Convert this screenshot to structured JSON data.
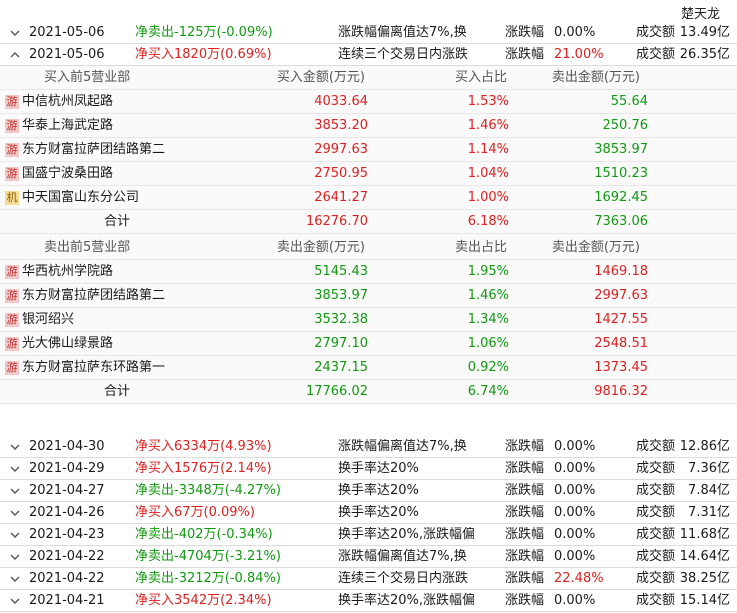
{
  "top_name": "楚天龙",
  "rows_top": [
    {
      "date": "2021-05-06",
      "flow": "净卖出-125万(-0.09%)",
      "flow_color": "green",
      "reason": "涨跌幅偏离值达7%,换",
      "pct_label": "涨跌幅",
      "pct": "0.00%",
      "pct_color": "normal",
      "tv_label": "成交额",
      "tv": "13.49亿",
      "expanded": false
    },
    {
      "date": "2021-05-06",
      "flow": "净买入1820万(0.69%)",
      "flow_color": "red",
      "reason": "连续三个交易日内涨跌",
      "pct_label": "涨跌幅",
      "pct": "21.00%",
      "pct_color": "red",
      "tv_label": "成交额",
      "tv": "26.35亿",
      "expanded": true
    }
  ],
  "buy_section": {
    "header": {
      "name": "买入前5营业部",
      "c1": "买入金额(万元)",
      "c2": "买入占比",
      "c3": "卖出金额(万元)"
    },
    "rows": [
      {
        "badge": "游",
        "badge_type": "you",
        "name": "中信杭州凤起路",
        "c1": "4033.64",
        "c2": "1.53%",
        "c3": "55.64"
      },
      {
        "badge": "游",
        "badge_type": "you",
        "name": "华泰上海武定路",
        "c1": "3853.20",
        "c2": "1.46%",
        "c3": "250.76"
      },
      {
        "badge": "游",
        "badge_type": "you",
        "name": "东方财富拉萨团结路第二",
        "c1": "2997.63",
        "c2": "1.14%",
        "c3": "3853.97"
      },
      {
        "badge": "游",
        "badge_type": "you",
        "name": "国盛宁波桑田路",
        "c1": "2750.95",
        "c2": "1.04%",
        "c3": "1510.23"
      },
      {
        "badge": "机",
        "badge_type": "ji",
        "name": "中天国富山东分公司",
        "c1": "2641.27",
        "c2": "1.00%",
        "c3": "1692.45"
      }
    ],
    "total": {
      "name": "合计",
      "c1": "16276.70",
      "c2": "6.18%",
      "c3": "7363.06"
    }
  },
  "sell_section": {
    "header": {
      "name": "卖出前5营业部",
      "c1": "卖出金额(万元)",
      "c2": "卖出占比",
      "c3": "卖出金额(万元)"
    },
    "rows": [
      {
        "badge": "游",
        "badge_type": "you",
        "name": "华西杭州学院路",
        "c1": "5145.43",
        "c2": "1.95%",
        "c3": "1469.18"
      },
      {
        "badge": "游",
        "badge_type": "you",
        "name": "东方财富拉萨团结路第二",
        "c1": "3853.97",
        "c2": "1.46%",
        "c3": "2997.63"
      },
      {
        "badge": "游",
        "badge_type": "you",
        "name": "银河绍兴",
        "c1": "3532.38",
        "c2": "1.34%",
        "c3": "1427.55"
      },
      {
        "badge": "游",
        "badge_type": "you",
        "name": "光大佛山绿景路",
        "c1": "2797.10",
        "c2": "1.06%",
        "c3": "2548.51"
      },
      {
        "badge": "游",
        "badge_type": "you",
        "name": "东方财富拉萨东环路第一",
        "c1": "2437.15",
        "c2": "0.92%",
        "c3": "1373.45"
      }
    ],
    "total": {
      "name": "合计",
      "c1": "17766.02",
      "c2": "6.74%",
      "c3": "9816.32"
    }
  },
  "rows_bottom": [
    {
      "date": "2021-04-30",
      "flow": "净买入6334万(4.93%)",
      "flow_color": "red",
      "reason": "涨跌幅偏离值达7%,换",
      "pct_label": "涨跌幅",
      "pct": "0.00%",
      "pct_color": "normal",
      "tv_label": "成交额",
      "tv": "12.86亿",
      "expanded": false
    },
    {
      "date": "2021-04-29",
      "flow": "净买入1576万(2.14%)",
      "flow_color": "red",
      "reason": "换手率达20%",
      "pct_label": "涨跌幅",
      "pct": "0.00%",
      "pct_color": "normal",
      "tv_label": "成交额",
      "tv": "7.36亿",
      "expanded": false
    },
    {
      "date": "2021-04-27",
      "flow": "净卖出-3348万(-4.27%)",
      "flow_color": "green",
      "reason": "换手率达20%",
      "pct_label": "涨跌幅",
      "pct": "0.00%",
      "pct_color": "normal",
      "tv_label": "成交额",
      "tv": "7.84亿",
      "expanded": false
    },
    {
      "date": "2021-04-26",
      "flow": "净买入67万(0.09%)",
      "flow_color": "red",
      "reason": "换手率达20%",
      "pct_label": "涨跌幅",
      "pct": "0.00%",
      "pct_color": "normal",
      "tv_label": "成交额",
      "tv": "7.31亿",
      "expanded": false
    },
    {
      "date": "2021-04-23",
      "flow": "净卖出-402万(-0.34%)",
      "flow_color": "green",
      "reason": "换手率达20%,涨跌幅偏",
      "pct_label": "涨跌幅",
      "pct": "0.00%",
      "pct_color": "normal",
      "tv_label": "成交额",
      "tv": "11.68亿",
      "expanded": false
    },
    {
      "date": "2021-04-22",
      "flow": "净卖出-4704万(-3.21%)",
      "flow_color": "green",
      "reason": "涨跌幅偏离值达7%,换",
      "pct_label": "涨跌幅",
      "pct": "0.00%",
      "pct_color": "normal",
      "tv_label": "成交额",
      "tv": "14.64亿",
      "expanded": false
    },
    {
      "date": "2021-04-22",
      "flow": "净卖出-3212万(-0.84%)",
      "flow_color": "green",
      "reason": "连续三个交易日内涨跌",
      "pct_label": "涨跌幅",
      "pct": "22.48%",
      "pct_color": "red",
      "tv_label": "成交额",
      "tv": "38.25亿",
      "expanded": false
    },
    {
      "date": "2021-04-21",
      "flow": "净买入3542万(2.34%)",
      "flow_color": "red",
      "reason": "换手率达20%,涨跌幅偏",
      "pct_label": "涨跌幅",
      "pct": "0.00%",
      "pct_color": "normal",
      "tv_label": "成交额",
      "tv": "15.14亿",
      "expanded": false
    }
  ]
}
